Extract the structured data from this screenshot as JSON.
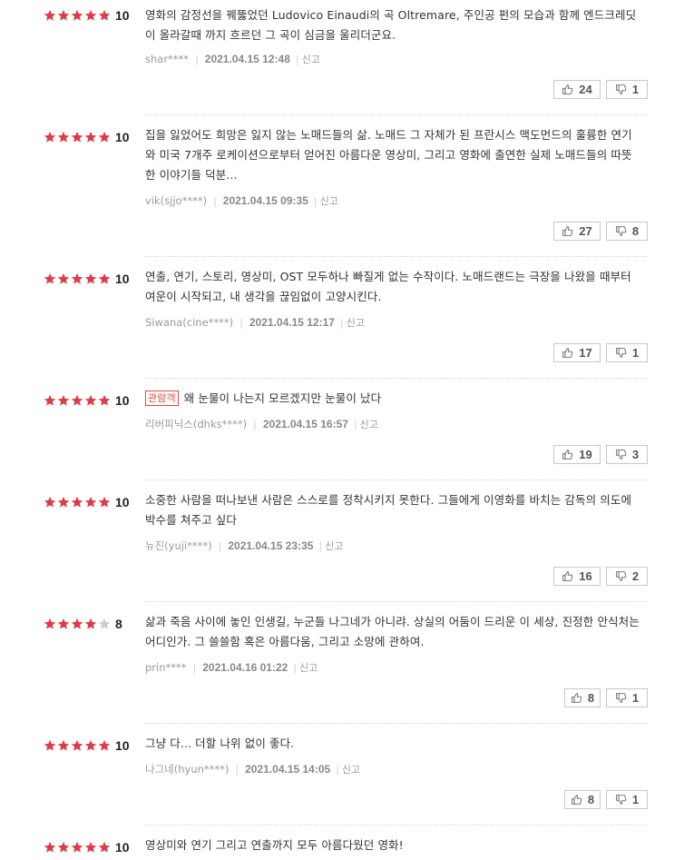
{
  "ui": {
    "report_label": "신고",
    "badge_label": "관람객"
  },
  "colors": {
    "star_on": "#e03a4a",
    "star_off": "#cccccc",
    "badge": "#e0483f"
  },
  "reviews": [
    {
      "rating": 5,
      "score": "10",
      "badge": false,
      "text": "영화의 감정선을 꿰뚫었던 Ludovico Einaudi의 곡 Oltremare, 주인공 펀의 모습과 함께 엔드크레딧이 올라갈때 까지 흐르던 그 곡이 심금을 울리더군요.",
      "author": "shar****",
      "date": "2021.04.15 12:48",
      "likes": "24",
      "dislikes": "1"
    },
    {
      "rating": 5,
      "score": "10",
      "badge": false,
      "text": "집을 잃었어도 희망은 잃지 않는 노매드들의 삶. 노매드 그 자체가 된 프란시스 맥도먼드의 훌륭한 연기와 미국 7개주 로케이션으로부터 얻어진 아름다운 영상미, 그리고 영화에 출연한 실제 노매드들의 따뜻한 이야기들 덕분...",
      "author": "vik(sjjo****)",
      "date": "2021.04.15 09:35",
      "likes": "27",
      "dislikes": "8"
    },
    {
      "rating": 5,
      "score": "10",
      "badge": false,
      "text": "연출, 연기, 스토리, 영상미, OST 모두하나 빠질게 없는 수작이다. 노매드랜드는 극장을 나왔을 때부터 여운이 시작되고, 내 생각을 끊임없이 고양시킨다.",
      "author": "Siwana(cine****)",
      "date": "2021.04.15 12:17",
      "likes": "17",
      "dislikes": "1"
    },
    {
      "rating": 5,
      "score": "10",
      "badge": true,
      "text": "왜 눈물이 나는지 모르겠지만 눈물이 났다",
      "author": "리버피닉스(dhks****)",
      "date": "2021.04.15 16:57",
      "likes": "19",
      "dislikes": "3"
    },
    {
      "rating": 5,
      "score": "10",
      "badge": false,
      "text": "소중한 사람을 떠나보낸 사람은 스스로를 정착시키지 못한다. 그들에게 이영화를 바치는 감독의 의도에 박수를 쳐주고 싶다",
      "author": "뉴진(yuji****)",
      "date": "2021.04.15 23:35",
      "likes": "16",
      "dislikes": "2"
    },
    {
      "rating": 4,
      "score": "8",
      "badge": false,
      "text": "삶과 죽음 사이에 놓인 인생길, 누군들 나그네가 아니랴. 상실의 어둠이 드리운 이 세상, 진정한 안식처는 어디인가. 그 쓸쓸함 혹은 아름다움, 그리고 소망에 관하여.",
      "author": "prin****",
      "date": "2021.04.16 01:22",
      "likes": "8",
      "dislikes": "1"
    },
    {
      "rating": 5,
      "score": "10",
      "badge": false,
      "text": "그냥 다... 더할 나위 없이 좋다.",
      "author": "나그네(hyun****)",
      "date": "2021.04.15 14:05",
      "likes": "8",
      "dislikes": "1"
    },
    {
      "rating": 5,
      "score": "10",
      "badge": false,
      "text": "영상미와 연기 그리고 연출까지 모두 아름다웠던 영화!",
      "author": "",
      "date": "",
      "likes": "",
      "dislikes": ""
    }
  ]
}
